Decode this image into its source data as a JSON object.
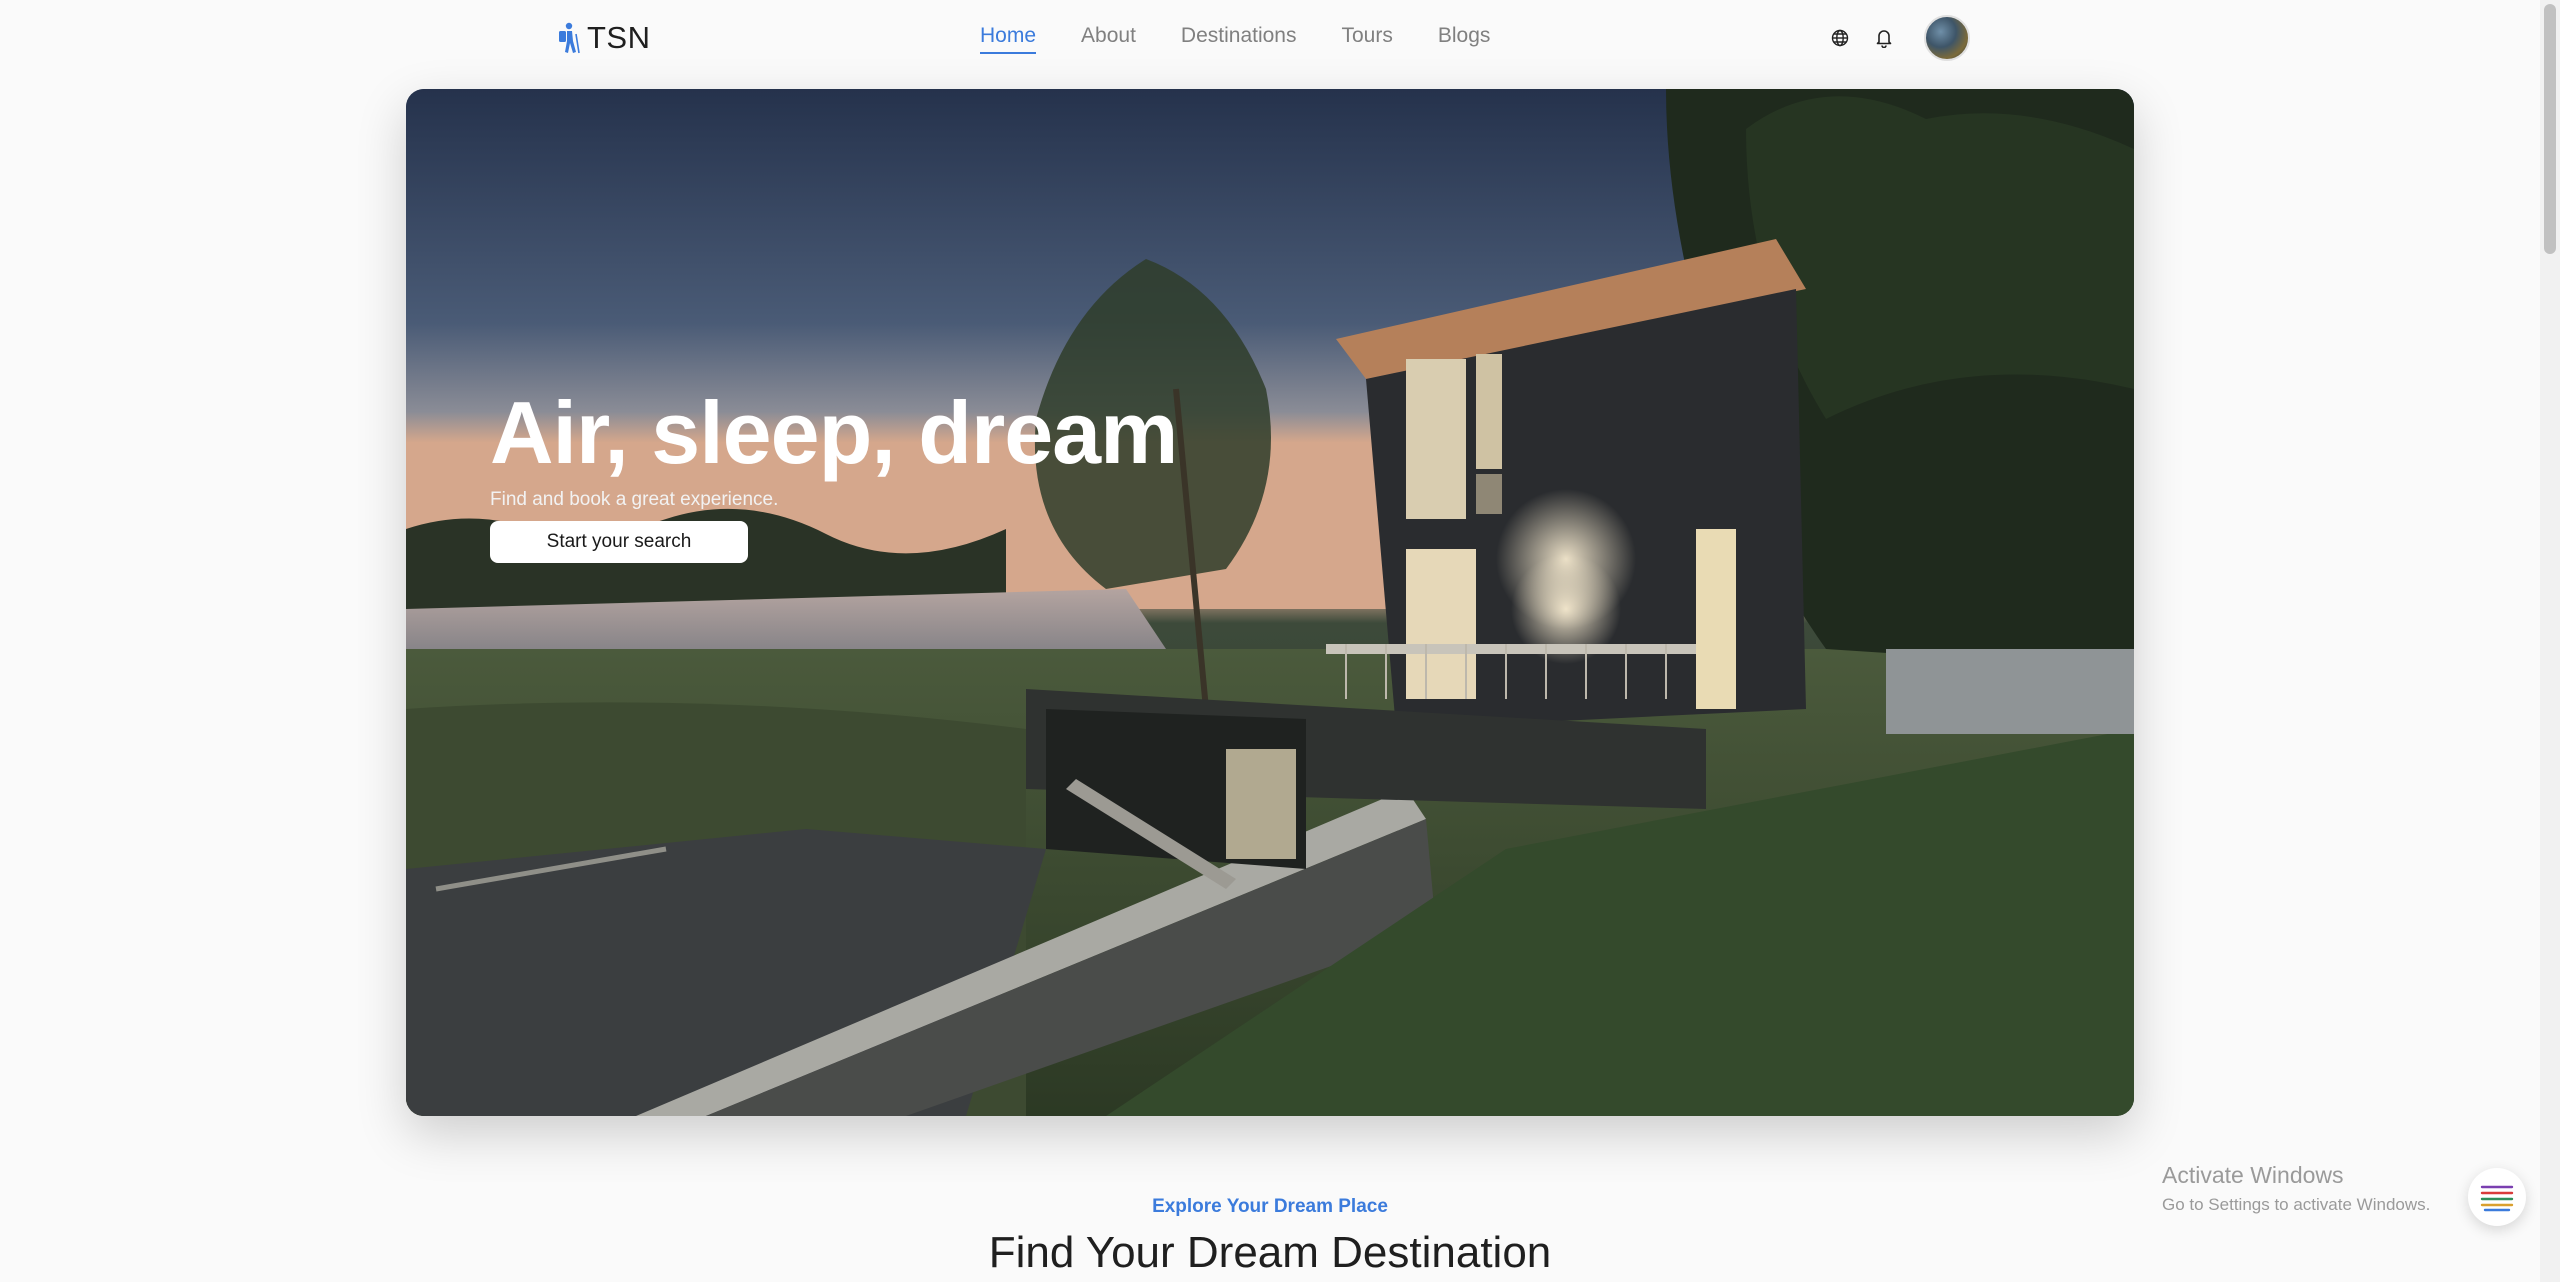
{
  "header": {
    "logo_text": "TSN",
    "nav": [
      {
        "label": "Home",
        "active": true
      },
      {
        "label": "About",
        "active": false
      },
      {
        "label": "Destinations",
        "active": false
      },
      {
        "label": "Tours",
        "active": false
      },
      {
        "label": "Blogs",
        "active": false
      }
    ],
    "icons": [
      "globe-icon",
      "bell-icon"
    ]
  },
  "hero": {
    "title": "Air, sleep, dream",
    "subtitle": "Find and book a great experience.",
    "button_label": "Start your search"
  },
  "section": {
    "kicker": "Explore Your Dream Place",
    "title": "Find Your Dream Destination"
  },
  "watermark": {
    "title": "Activate Windows",
    "subtitle": "Go to Settings to activate Windows."
  },
  "colors": {
    "accent": "#3b7bdc",
    "background": "#fafafa"
  }
}
